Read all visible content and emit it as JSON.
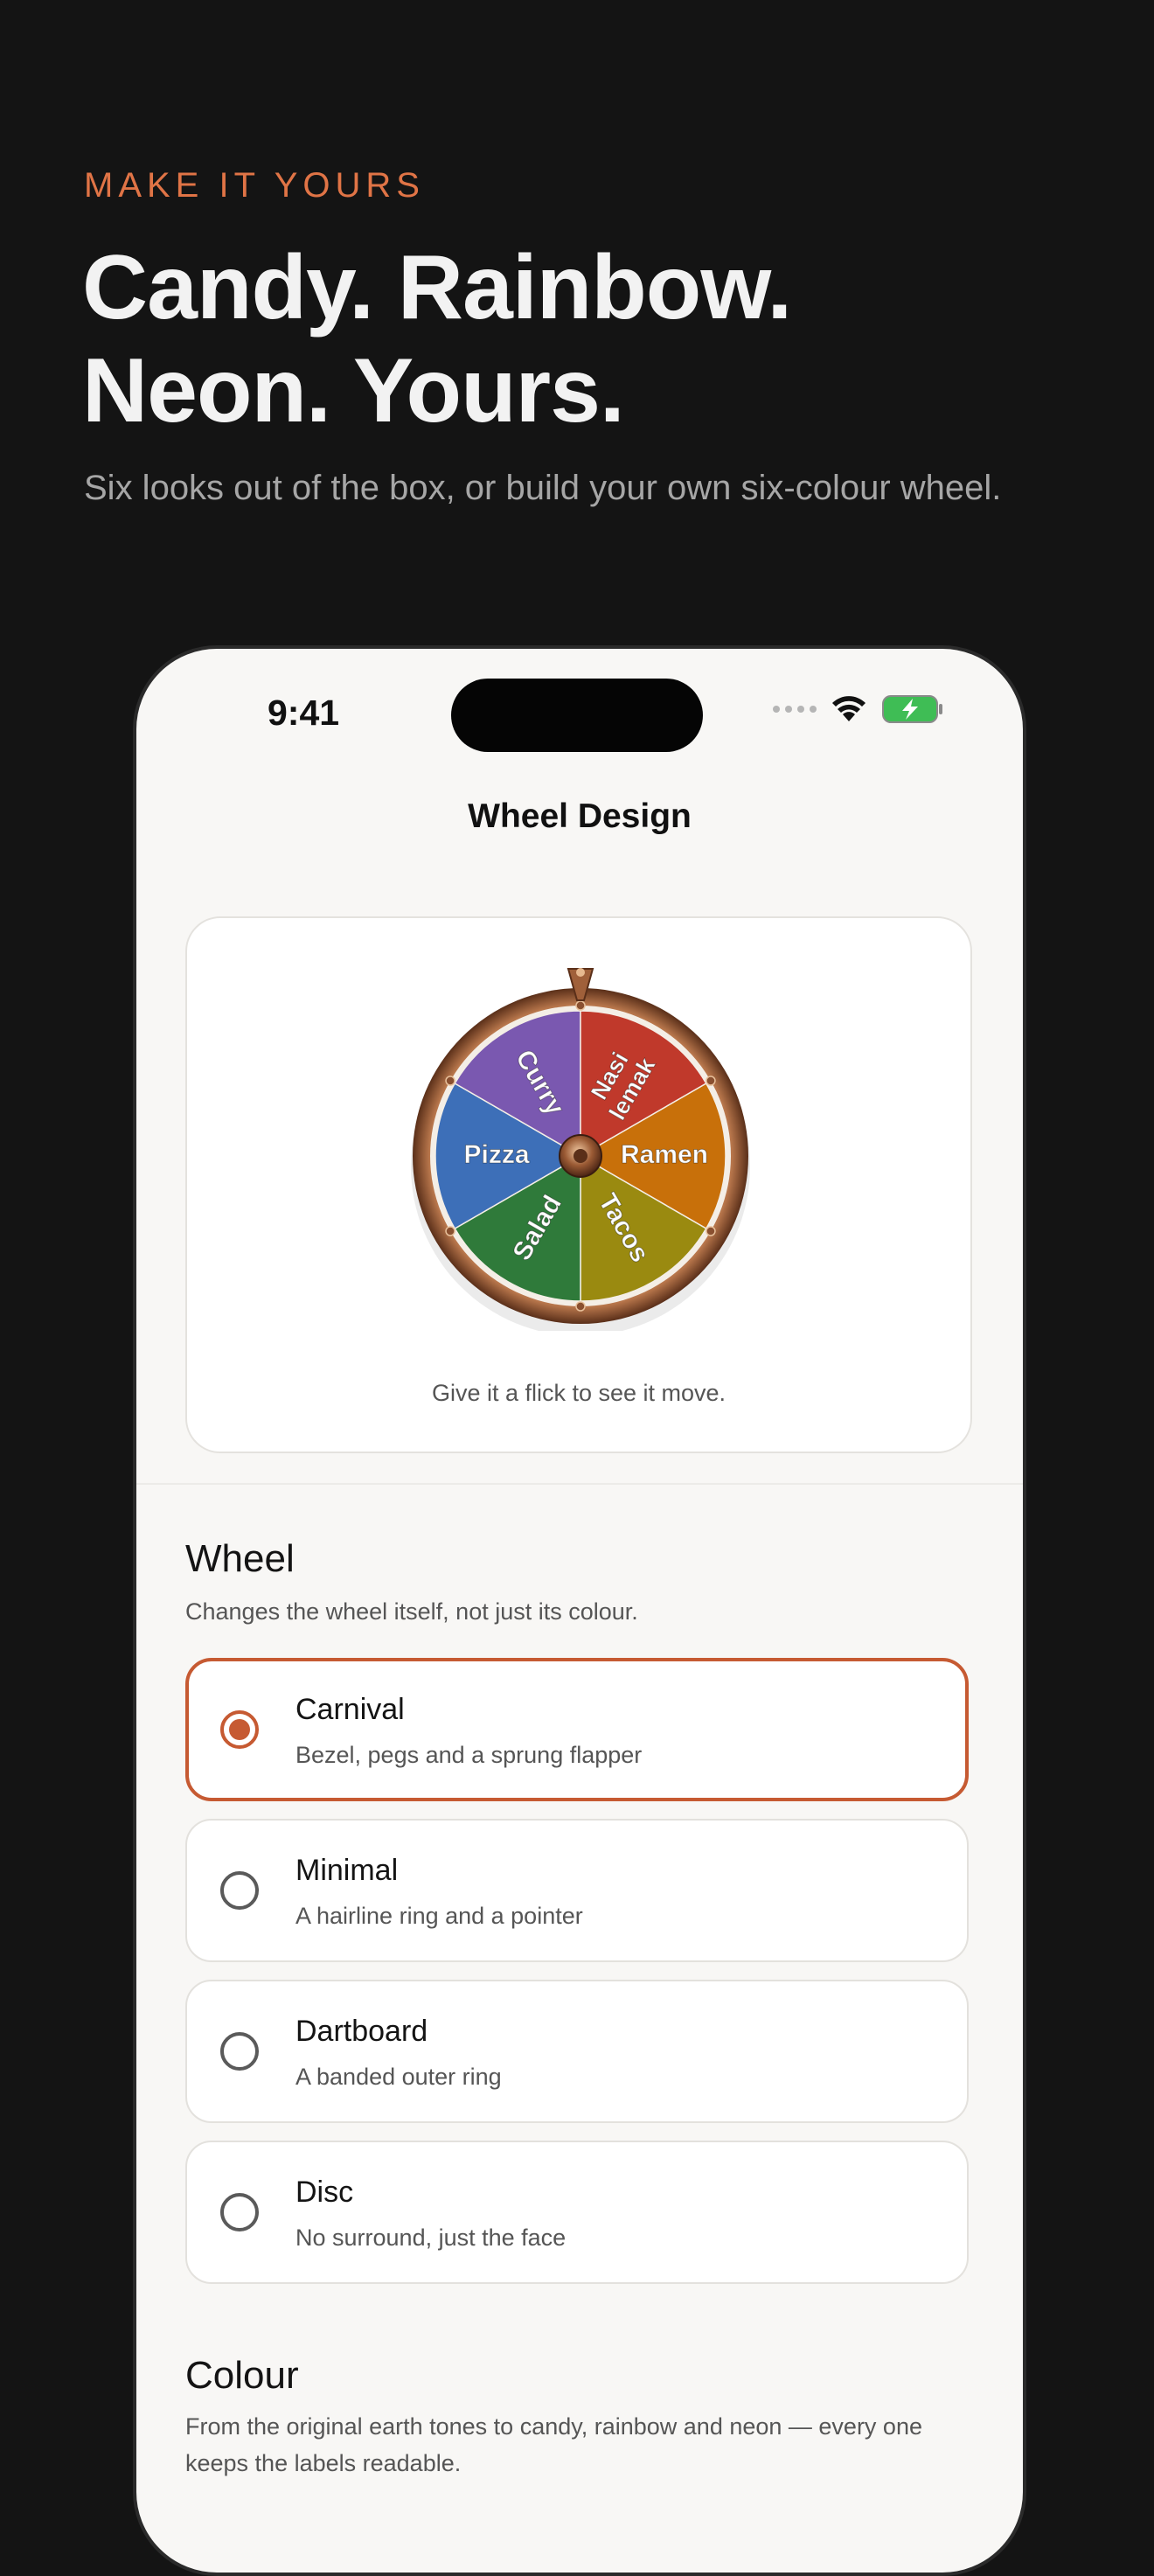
{
  "hero": {
    "eyebrow": "MAKE IT YOURS",
    "title_line1": "Candy. Rainbow.",
    "title_line2": "Neon. Yours.",
    "subtitle": "Six looks out of the box, or build your own six-colour wheel."
  },
  "status_bar": {
    "time": "9:41"
  },
  "nav": {
    "title": "Wheel Design"
  },
  "preview": {
    "caption": "Give it a flick to see it move.",
    "segments": [
      {
        "label": "Ramen",
        "color": "#c8700a"
      },
      {
        "label": "Tacos",
        "color": "#9a8a10"
      },
      {
        "label": "Salad",
        "color": "#2f7a3a"
      },
      {
        "label": "Pizza",
        "color": "#3d6fb8"
      },
      {
        "label": "Curry",
        "color": "#7a58b0"
      },
      {
        "label": "Nasi lemak",
        "color": "#c0392b"
      }
    ]
  },
  "wheel_section": {
    "title": "Wheel",
    "description": "Changes the wheel itself, not just its colour.",
    "options": [
      {
        "name": "Carnival",
        "description": "Bezel, pegs and a sprung flapper",
        "selected": true
      },
      {
        "name": "Minimal",
        "description": "A hairline ring and a pointer",
        "selected": false
      },
      {
        "name": "Dartboard",
        "description": "A banded outer ring",
        "selected": false
      },
      {
        "name": "Disc",
        "description": "No surround, just the face",
        "selected": false
      }
    ]
  },
  "colour_section": {
    "title": "Colour",
    "description": "From the original earth tones to candy, rainbow and neon — every one keeps the labels readable."
  },
  "colors": {
    "accent": "#c65a32",
    "eyebrow": "#e07446"
  }
}
